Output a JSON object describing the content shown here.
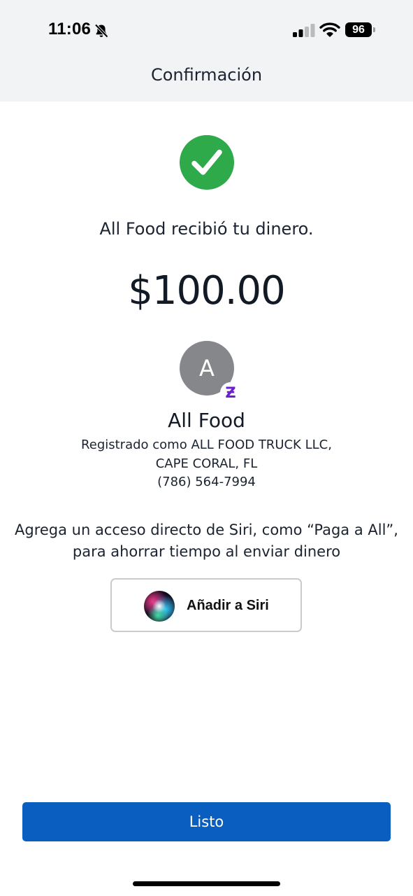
{
  "status_bar": {
    "time": "11:06",
    "battery_level": "96",
    "icons": [
      "bell-off-icon",
      "signal-icon",
      "wifi-icon",
      "battery-icon"
    ]
  },
  "header": {
    "title": "Confirmación"
  },
  "confirmation": {
    "status_icon": "check-circle-icon",
    "message": "All Food recibió tu dinero.",
    "amount": "$100.00"
  },
  "recipient": {
    "avatar_initial": "A",
    "badge_icon": "zelle-z-icon",
    "badge_text": "Ƶ",
    "name": "All Food",
    "registered_as": "Registrado como ALL FOOD TRUCK LLC, CAPE CORAL, FL",
    "phone": "(786) 564-7994"
  },
  "siri": {
    "promo_text": "Agrega un acceso directo de Siri, como “Paga a All”, para ahorrar tiempo al enviar dinero",
    "button_label": "Añadir a Siri",
    "button_icon": "siri-icon"
  },
  "footer": {
    "done_label": "Listo"
  },
  "colors": {
    "success": "#2eaa4a",
    "primary_button": "#0a5ec0",
    "zelle_purple": "#6d1ed4",
    "header_background": "#f2f3f5"
  }
}
